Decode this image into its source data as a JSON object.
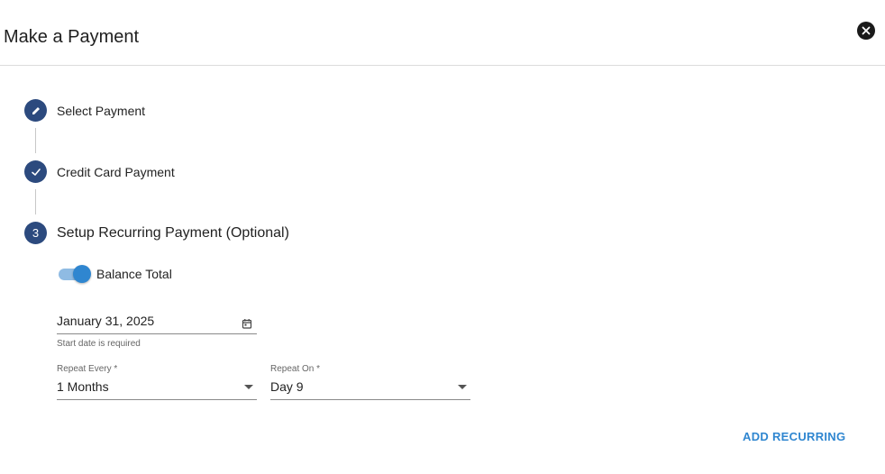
{
  "dialog": {
    "title": "Make a Payment",
    "close_icon": "close-circle-icon"
  },
  "steps": [
    {
      "label": "Select Payment",
      "icon": "pencil-icon",
      "state": "completed-editable"
    },
    {
      "label": "Credit Card Payment",
      "icon": "check-icon",
      "state": "completed"
    },
    {
      "label": "Setup Recurring Payment (Optional)",
      "number": "3",
      "state": "active"
    }
  ],
  "recurring": {
    "toggle_label": "Balance Total",
    "toggle_on": true,
    "start_date": {
      "value": "January 31, 2025",
      "helper": "Start date is required",
      "icon": "calendar-icon"
    },
    "repeat_every": {
      "label": "Repeat Every *",
      "value": "1 Months"
    },
    "repeat_on": {
      "label": "Repeat On *",
      "value": "Day 9"
    }
  },
  "actions": {
    "add_recurring_label": "ADD RECURRING"
  },
  "colors": {
    "step_circle": "#2c4a7e",
    "accent": "#2f86d0",
    "toggle_track": "#8fbbe3"
  }
}
